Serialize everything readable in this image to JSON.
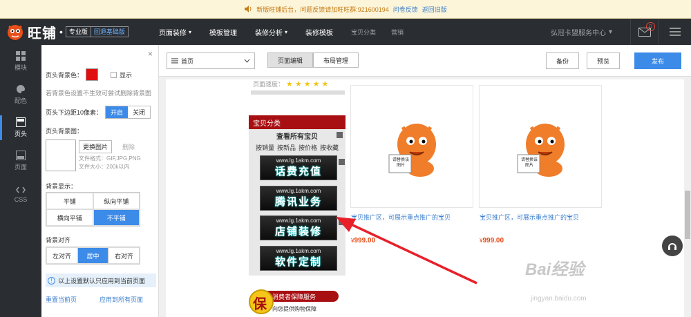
{
  "notice": {
    "text": "新版旺铺后台，问题反馈请加旺旺群:921600194",
    "link1": "问卷反馈",
    "link2": "返回旧版"
  },
  "topbar": {
    "brand": "旺铺",
    "edition_pro": "专业版",
    "edition_basic": "回退基础版",
    "nav": [
      {
        "label": "页面装修",
        "caret": "▾"
      },
      {
        "label": "模板管理",
        "caret": ""
      },
      {
        "label": "装修分析",
        "caret": "▾"
      },
      {
        "label": "装修模板",
        "caret": ""
      },
      {
        "label": "宝贝分类",
        "caret": ""
      },
      {
        "label": "营销",
        "caret": ""
      }
    ],
    "store_name": "弘冠卡盟服务中心",
    "store_caret": "▾",
    "mail_count": "0"
  },
  "iconbar": {
    "items": [
      {
        "label": "模块",
        "icon": "grid-icon"
      },
      {
        "label": "配色",
        "icon": "palette-icon"
      },
      {
        "label": "页头",
        "icon": "header-icon"
      },
      {
        "label": "页面",
        "icon": "page-icon"
      },
      {
        "label": "CSS",
        "icon": "code-icon"
      }
    ]
  },
  "panel": {
    "close": "×",
    "bg_color_label": "页头背景色：",
    "show_label": "显示",
    "bg_hint": "若背景色设置不生效可尝试删除背景图",
    "margin_label": "页头下边距10像素：",
    "margin_on": "开启",
    "margin_off": "关闭",
    "bg_image_label": "页头背景图：",
    "replace_image": "更换图片",
    "delete": "删除",
    "file_format": "文件格式：GIF,JPG,PNG",
    "file_size": "文件大小：200k以内",
    "bg_display_label": "背景显示：",
    "display_options": [
      "平铺",
      "纵向平铺",
      "横向平铺",
      "不平铺"
    ],
    "bg_align_label": "背景对齐",
    "align_options": [
      "左对齐",
      "居中",
      "右对齐"
    ],
    "info": "以上设置默认只应用到当前页面",
    "reset": "重置当前页",
    "apply_all": "应用到所有页面",
    "swatch_color": "#e01010"
  },
  "toolbar": {
    "page_select": "首页",
    "tabs": [
      "页面编辑",
      "布局管理"
    ],
    "backup": "备份",
    "preview": "预览",
    "publish": "发布"
  },
  "canvas": {
    "rating_label": "页面速度：",
    "category": {
      "title": "宝贝分类",
      "view_all": "查看所有宝贝",
      "sorts": [
        "按销量",
        "按新品",
        "按价格",
        "按收藏"
      ],
      "banners": [
        {
          "url": "www.lg.1akm.com",
          "text": "话费充值"
        },
        {
          "url": "www.lg.1akm.com",
          "text": "腾讯业务"
        },
        {
          "url": "www.lg.1akm.com",
          "text": "店铺装修"
        },
        {
          "url": "www.lg.1akm.com",
          "text": "软件定制"
        }
      ]
    },
    "products": [
      {
        "title": "宝贝推广区，可展示重点推广的宝贝",
        "price": "999.00",
        "currency": "¥",
        "placeholder": "请替换该图片"
      },
      {
        "title": "宝贝推广区，可展示重点推广的宝贝",
        "price": "999.00",
        "currency": "¥",
        "placeholder": "请替换该图片"
      }
    ],
    "guarantee_title": "消费者保障服务",
    "guarantee_sub": "向您提供购物保障",
    "guarantee_char": "保"
  },
  "watermark": {
    "text": "Bai经验",
    "url": "jingyan.baidu.com"
  }
}
